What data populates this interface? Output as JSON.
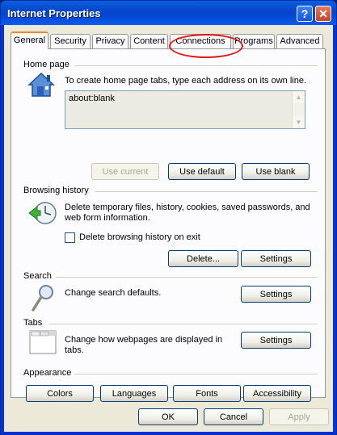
{
  "window": {
    "title": "Internet Properties",
    "help_glyph": "?",
    "close_glyph": "✕"
  },
  "tabs": [
    {
      "label": "General",
      "active": true
    },
    {
      "label": "Security"
    },
    {
      "label": "Privacy"
    },
    {
      "label": "Content"
    },
    {
      "label": "Connections"
    },
    {
      "label": "Programs"
    },
    {
      "label": "Advanced"
    }
  ],
  "home_page": {
    "group_title": "Home page",
    "description": "To create home page tabs, type each address on its own line.",
    "value": "about:blank",
    "use_current": "Use current",
    "use_default": "Use default",
    "use_blank": "Use blank"
  },
  "browsing_history": {
    "group_title": "Browsing history",
    "description": "Delete temporary files, history, cookies, saved passwords, and web form information.",
    "checkbox_label": "Delete browsing history on exit",
    "checked": false,
    "delete": "Delete...",
    "settings": "Settings"
  },
  "search": {
    "group_title": "Search",
    "description": "Change search defaults.",
    "settings": "Settings"
  },
  "tabs_section": {
    "group_title": "Tabs",
    "description": "Change how webpages are displayed in tabs.",
    "settings": "Settings"
  },
  "appearance": {
    "group_title": "Appearance",
    "colors": "Colors",
    "languages": "Languages",
    "fonts": "Fonts",
    "accessibility": "Accessibility"
  },
  "footer": {
    "ok": "OK",
    "cancel": "Cancel",
    "apply": "Apply"
  },
  "colors": {
    "title_bar": "#0a5fe0",
    "highlight": "#e0181c",
    "active_tab_accent": "#e68b2c"
  }
}
